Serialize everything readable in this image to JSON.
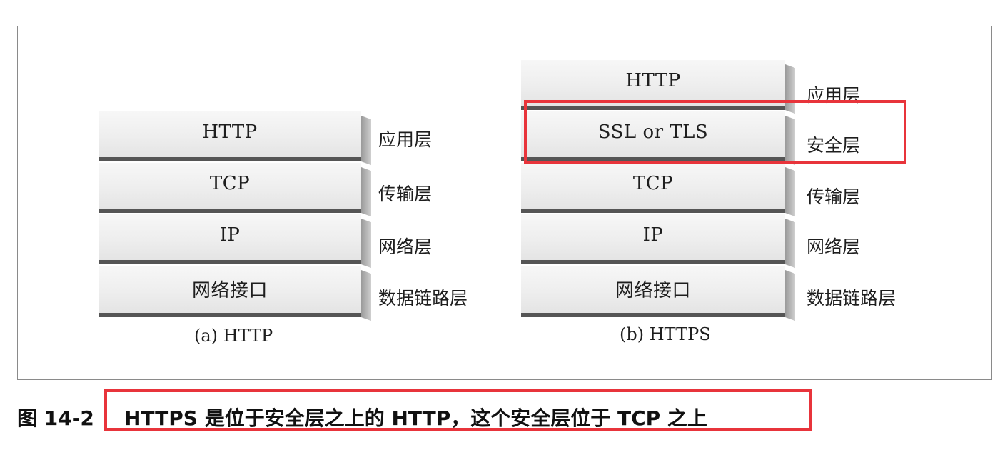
{
  "stacks": {
    "http": {
      "caption": "(a) HTTP",
      "layers": [
        {
          "name": "HTTP",
          "role": "应用层"
        },
        {
          "name": "TCP",
          "role": "传输层"
        },
        {
          "name": "IP",
          "role": "网络层"
        },
        {
          "name": "网络接口",
          "role": "数据链路层"
        }
      ]
    },
    "https": {
      "caption": "(b) HTTPS",
      "layers": [
        {
          "name": "HTTP",
          "role": "应用层"
        },
        {
          "name": "SSL or TLS",
          "role": "安全层"
        },
        {
          "name": "TCP",
          "role": "传输层"
        },
        {
          "name": "IP",
          "role": "网络层"
        },
        {
          "name": "网络接口",
          "role": "数据链路层"
        }
      ]
    }
  },
  "figure": {
    "number": "图 14-2",
    "caption": "HTTPS 是位于安全层之上的 HTTP，这个安全层位于 TCP 之上"
  },
  "colors": {
    "highlight": "#e8343b",
    "layer_fill": "#eeeeee",
    "layer_shadow": "#555555"
  }
}
